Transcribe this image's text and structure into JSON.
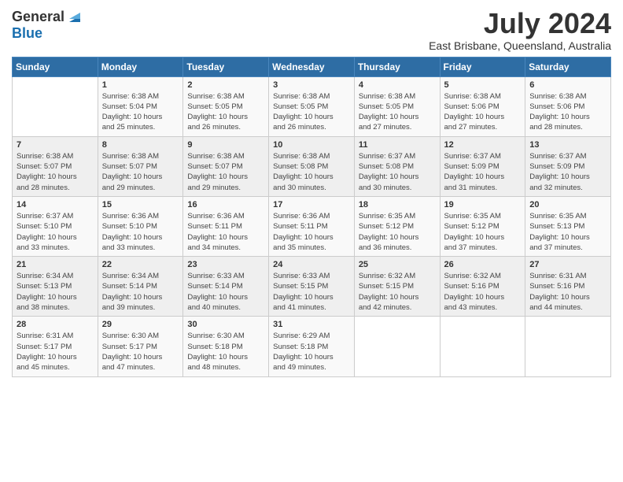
{
  "logo": {
    "general": "General",
    "blue": "Blue"
  },
  "title": "July 2024",
  "subtitle": "East Brisbane, Queensland, Australia",
  "weekdays": [
    "Sunday",
    "Monday",
    "Tuesday",
    "Wednesday",
    "Thursday",
    "Friday",
    "Saturday"
  ],
  "weeks": [
    [
      {
        "day": "",
        "info": ""
      },
      {
        "day": "1",
        "info": "Sunrise: 6:38 AM\nSunset: 5:04 PM\nDaylight: 10 hours\nand 25 minutes."
      },
      {
        "day": "2",
        "info": "Sunrise: 6:38 AM\nSunset: 5:05 PM\nDaylight: 10 hours\nand 26 minutes."
      },
      {
        "day": "3",
        "info": "Sunrise: 6:38 AM\nSunset: 5:05 PM\nDaylight: 10 hours\nand 26 minutes."
      },
      {
        "day": "4",
        "info": "Sunrise: 6:38 AM\nSunset: 5:05 PM\nDaylight: 10 hours\nand 27 minutes."
      },
      {
        "day": "5",
        "info": "Sunrise: 6:38 AM\nSunset: 5:06 PM\nDaylight: 10 hours\nand 27 minutes."
      },
      {
        "day": "6",
        "info": "Sunrise: 6:38 AM\nSunset: 5:06 PM\nDaylight: 10 hours\nand 28 minutes."
      }
    ],
    [
      {
        "day": "7",
        "info": "Sunrise: 6:38 AM\nSunset: 5:07 PM\nDaylight: 10 hours\nand 28 minutes."
      },
      {
        "day": "8",
        "info": "Sunrise: 6:38 AM\nSunset: 5:07 PM\nDaylight: 10 hours\nand 29 minutes."
      },
      {
        "day": "9",
        "info": "Sunrise: 6:38 AM\nSunset: 5:07 PM\nDaylight: 10 hours\nand 29 minutes."
      },
      {
        "day": "10",
        "info": "Sunrise: 6:38 AM\nSunset: 5:08 PM\nDaylight: 10 hours\nand 30 minutes."
      },
      {
        "day": "11",
        "info": "Sunrise: 6:37 AM\nSunset: 5:08 PM\nDaylight: 10 hours\nand 30 minutes."
      },
      {
        "day": "12",
        "info": "Sunrise: 6:37 AM\nSunset: 5:09 PM\nDaylight: 10 hours\nand 31 minutes."
      },
      {
        "day": "13",
        "info": "Sunrise: 6:37 AM\nSunset: 5:09 PM\nDaylight: 10 hours\nand 32 minutes."
      }
    ],
    [
      {
        "day": "14",
        "info": "Sunrise: 6:37 AM\nSunset: 5:10 PM\nDaylight: 10 hours\nand 33 minutes."
      },
      {
        "day": "15",
        "info": "Sunrise: 6:36 AM\nSunset: 5:10 PM\nDaylight: 10 hours\nand 33 minutes."
      },
      {
        "day": "16",
        "info": "Sunrise: 6:36 AM\nSunset: 5:11 PM\nDaylight: 10 hours\nand 34 minutes."
      },
      {
        "day": "17",
        "info": "Sunrise: 6:36 AM\nSunset: 5:11 PM\nDaylight: 10 hours\nand 35 minutes."
      },
      {
        "day": "18",
        "info": "Sunrise: 6:35 AM\nSunset: 5:12 PM\nDaylight: 10 hours\nand 36 minutes."
      },
      {
        "day": "19",
        "info": "Sunrise: 6:35 AM\nSunset: 5:12 PM\nDaylight: 10 hours\nand 37 minutes."
      },
      {
        "day": "20",
        "info": "Sunrise: 6:35 AM\nSunset: 5:13 PM\nDaylight: 10 hours\nand 37 minutes."
      }
    ],
    [
      {
        "day": "21",
        "info": "Sunrise: 6:34 AM\nSunset: 5:13 PM\nDaylight: 10 hours\nand 38 minutes."
      },
      {
        "day": "22",
        "info": "Sunrise: 6:34 AM\nSunset: 5:14 PM\nDaylight: 10 hours\nand 39 minutes."
      },
      {
        "day": "23",
        "info": "Sunrise: 6:33 AM\nSunset: 5:14 PM\nDaylight: 10 hours\nand 40 minutes."
      },
      {
        "day": "24",
        "info": "Sunrise: 6:33 AM\nSunset: 5:15 PM\nDaylight: 10 hours\nand 41 minutes."
      },
      {
        "day": "25",
        "info": "Sunrise: 6:32 AM\nSunset: 5:15 PM\nDaylight: 10 hours\nand 42 minutes."
      },
      {
        "day": "26",
        "info": "Sunrise: 6:32 AM\nSunset: 5:16 PM\nDaylight: 10 hours\nand 43 minutes."
      },
      {
        "day": "27",
        "info": "Sunrise: 6:31 AM\nSunset: 5:16 PM\nDaylight: 10 hours\nand 44 minutes."
      }
    ],
    [
      {
        "day": "28",
        "info": "Sunrise: 6:31 AM\nSunset: 5:17 PM\nDaylight: 10 hours\nand 45 minutes."
      },
      {
        "day": "29",
        "info": "Sunrise: 6:30 AM\nSunset: 5:17 PM\nDaylight: 10 hours\nand 47 minutes."
      },
      {
        "day": "30",
        "info": "Sunrise: 6:30 AM\nSunset: 5:18 PM\nDaylight: 10 hours\nand 48 minutes."
      },
      {
        "day": "31",
        "info": "Sunrise: 6:29 AM\nSunset: 5:18 PM\nDaylight: 10 hours\nand 49 minutes."
      },
      {
        "day": "",
        "info": ""
      },
      {
        "day": "",
        "info": ""
      },
      {
        "day": "",
        "info": ""
      }
    ]
  ]
}
